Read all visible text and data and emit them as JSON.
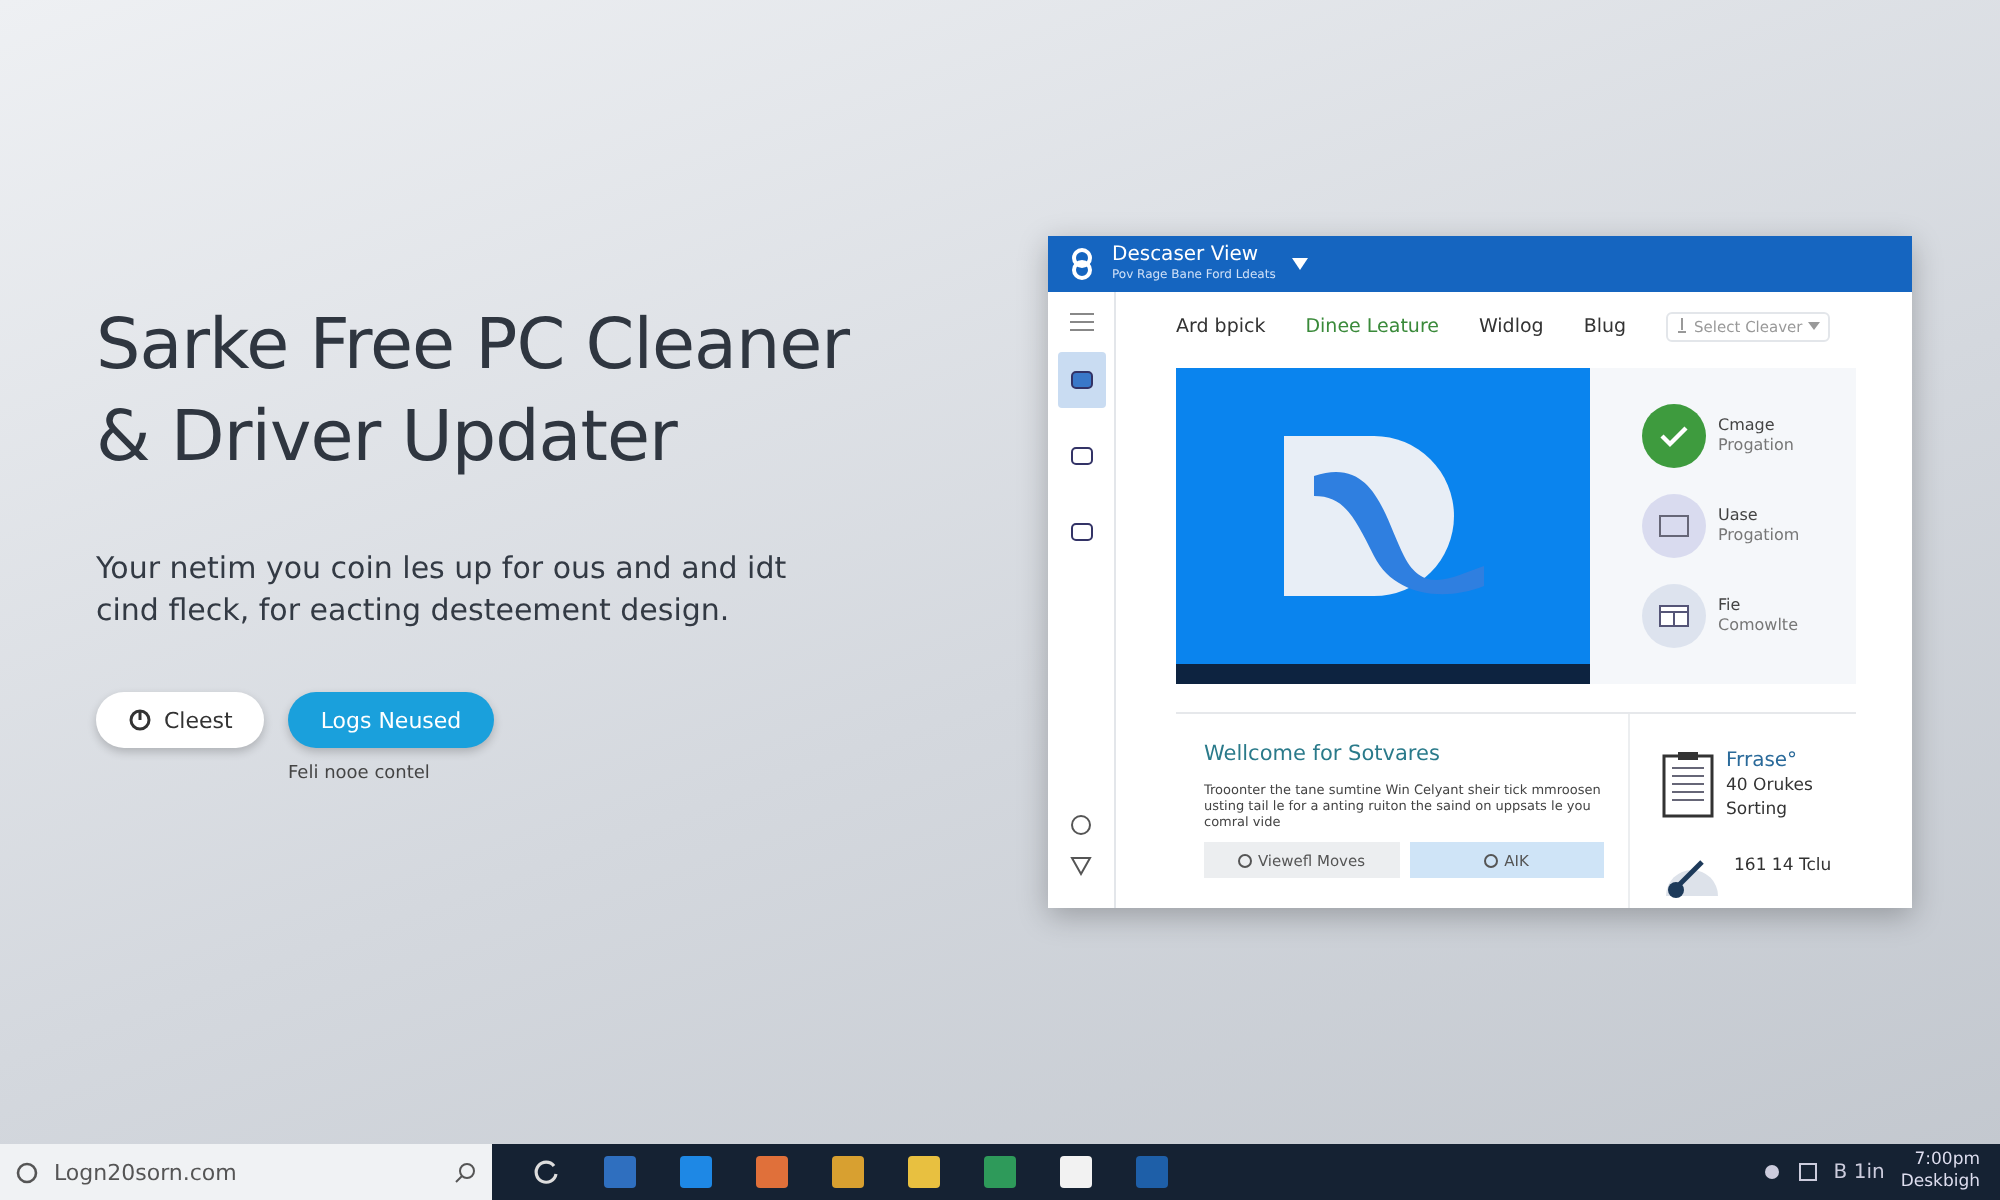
{
  "hero": {
    "title_lines": [
      "Sarke Free PC Cleaner",
      "& Driver Updater"
    ],
    "description": "Your netim you coin les up for ous and and idt cind fleck, for eacting desteement design.",
    "buttons": [
      {
        "label": "Cleest",
        "kind": "secondary"
      },
      {
        "label": "Logs Neused",
        "kind": "primary"
      }
    ],
    "caption": "Feli nooe contel"
  },
  "window": {
    "title": "Descaser View",
    "subtitle": "Pov Rage Bane Ford Ldeats",
    "sidebar": [
      {
        "selected": true
      },
      {
        "selected": false
      },
      {
        "selected": false
      }
    ],
    "nav": [
      {
        "label": "Ard bpick",
        "selected": false
      },
      {
        "label": "Dinee Leature",
        "selected": true
      },
      {
        "label": "Widlog",
        "selected": false
      },
      {
        "label": "Blug",
        "selected": false
      }
    ],
    "select": {
      "placeholder": "Select Cleaver"
    },
    "features": [
      {
        "title": "Cmage",
        "subtitle": "Progation",
        "kind": "check"
      },
      {
        "title": "Uase",
        "subtitle": "Progatiom",
        "kind": "monitor"
      },
      {
        "title": "Fie",
        "subtitle": "Comowlte",
        "kind": "panel"
      }
    ],
    "welcome": {
      "title": "Wellcome for Sotvares",
      "text": "Trooonter the tane sumtine Win Celyant sheir tick mmroosen usting tail le for a anting ruiton the saind on uppsats le you comral vide",
      "buttons": [
        {
          "label": "Viewefl Moves",
          "kind": "secondary"
        },
        {
          "label": "AIK",
          "kind": "primary"
        }
      ]
    },
    "side_cards": [
      {
        "lines": [
          "Frrase°",
          "40 Orukes",
          "Sorting"
        ],
        "kind": "document"
      },
      {
        "lines": [
          "161 14 Tclu"
        ],
        "kind": "gauge"
      }
    ]
  },
  "taskbar": {
    "search": {
      "value": "Logn20sorn.com"
    },
    "tray": [
      "B 1in"
    ],
    "time": "7:00pm",
    "date": "Deskbigh"
  }
}
